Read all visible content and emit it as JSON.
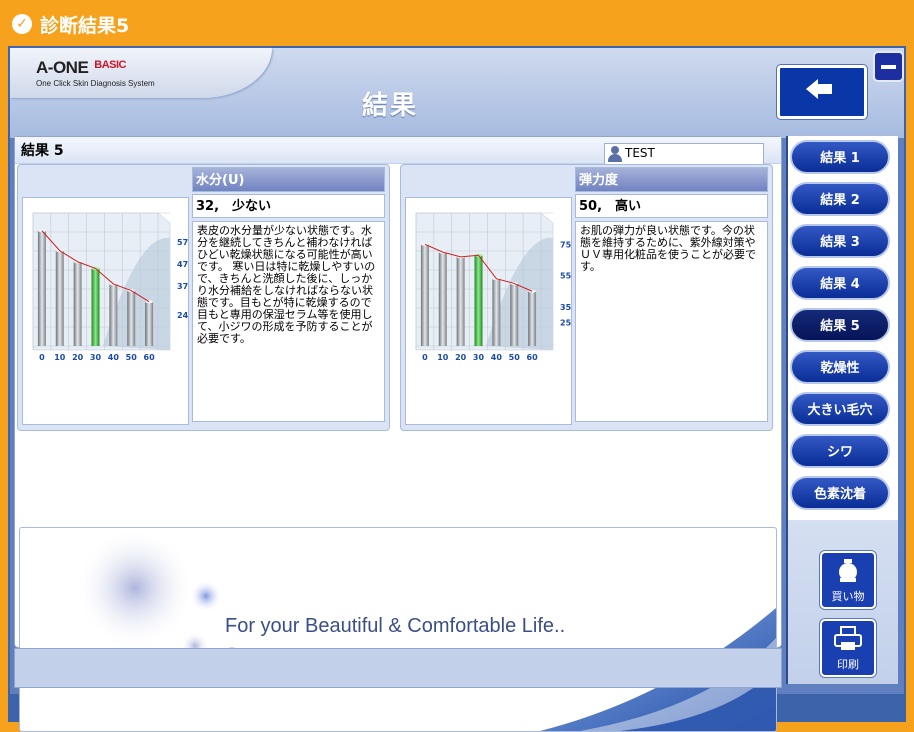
{
  "window": {
    "title": "診断結果5"
  },
  "app": {
    "logo_main": "A-ONE",
    "logo_edition": "BASIC",
    "logo_tagline": "One Click Skin Diagnosis System",
    "page_title": "結果"
  },
  "content": {
    "header_label": "結果 5",
    "user_name": "TEST",
    "left_panel": {
      "title": "水分(U)",
      "value": "32,　少ない",
      "description": "表皮の水分量が少ない状態です。水分を継続してきちんと補わなければひどい乾燥状態になる可能性が高いです。 寒い日は特に乾燥しやすいので、きちんと洗顔した後に、しっかり水分補給をしなければならない状態です。目もとが特に乾燥するので目もと専用の保湿セラム等を使用して、小ジワの形成を予防することが必要です。"
    },
    "right_panel": {
      "title": "弾力度",
      "value": "50,　高い",
      "description": "お肌の弾力が良い状態です。今の状態を維持するために、紫外線対策やＵＶ専用化粧品を使うことが必要です。"
    },
    "banner_text": "For your Beautiful & Comfortable Life.."
  },
  "sidebar": {
    "items": [
      {
        "label": "結果 1"
      },
      {
        "label": "結果 2"
      },
      {
        "label": "結果 3"
      },
      {
        "label": "結果 4"
      },
      {
        "label": "結果 5"
      },
      {
        "label": "乾燥性"
      },
      {
        "label": "大きい毛穴"
      },
      {
        "label": "シワ"
      },
      {
        "label": "色素沈着"
      }
    ],
    "active_index": 4,
    "shopping_label": "買い物",
    "print_label": "印刷"
  },
  "colors": {
    "accent": "#f6a21c",
    "frame": "#3d63ab",
    "button": "#0a2d96",
    "bar_normal": "#9aa0a6",
    "bar_highlight": "#3fbf3f",
    "trend_line": "#d21e1e",
    "axis_label": "#1a4aa8"
  },
  "chart_data": [
    {
      "type": "bar",
      "categories": [
        "0",
        "10",
        "20",
        "30",
        "40",
        "50",
        "60"
      ],
      "highlight_category": "30",
      "values": [
        62,
        53,
        48,
        45,
        38,
        35,
        30
      ],
      "ytick_labels": [
        "57",
        "47",
        "37",
        "24"
      ],
      "ytick_values": [
        57,
        47,
        37,
        24
      ],
      "ylim": [
        10,
        70
      ],
      "grid": true
    },
    {
      "type": "bar",
      "categories": [
        "0",
        "10",
        "20",
        "30",
        "40",
        "50",
        "60"
      ],
      "highlight_category": "30",
      "values": [
        75,
        70,
        67,
        68,
        53,
        50,
        45
      ],
      "ytick_labels": [
        "75",
        "55",
        "35",
        "25"
      ],
      "ytick_values": [
        75,
        55,
        35,
        25
      ],
      "ylim": [
        10,
        95
      ],
      "grid": true
    }
  ]
}
